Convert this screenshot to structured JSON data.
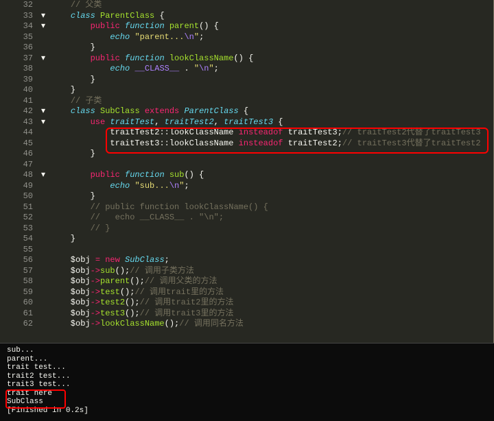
{
  "lines": [
    {
      "num": 32,
      "fold": "",
      "tokens": [
        [
          "    ",
          "pln"
        ],
        [
          "// 父类",
          "c-comment"
        ]
      ]
    },
    {
      "num": 33,
      "fold": "▾",
      "tokens": [
        [
          "    ",
          "pln"
        ],
        [
          "class",
          "c-keyword"
        ],
        [
          " ",
          "pln"
        ],
        [
          "ParentClass",
          "c-class"
        ],
        [
          " {",
          "pln"
        ]
      ]
    },
    {
      "num": 34,
      "fold": "▾",
      "tokens": [
        [
          "        ",
          "pln"
        ],
        [
          "public",
          "c-kw3"
        ],
        [
          " ",
          "pln"
        ],
        [
          "function",
          "c-keyword"
        ],
        [
          " ",
          "pln"
        ],
        [
          "parent",
          "c-func"
        ],
        [
          "() {",
          "pln"
        ]
      ]
    },
    {
      "num": 35,
      "fold": "",
      "tokens": [
        [
          "            ",
          "pln"
        ],
        [
          "echo",
          "c-keyword"
        ],
        [
          " ",
          "pln"
        ],
        [
          "\"parent...",
          "c-string"
        ],
        [
          "\\n",
          "c-escape"
        ],
        [
          "\"",
          "c-string"
        ],
        [
          ";",
          "pln"
        ]
      ]
    },
    {
      "num": 36,
      "fold": "",
      "tokens": [
        [
          "        }",
          "pln"
        ]
      ]
    },
    {
      "num": 37,
      "fold": "▾",
      "tokens": [
        [
          "        ",
          "pln"
        ],
        [
          "public",
          "c-kw3"
        ],
        [
          " ",
          "pln"
        ],
        [
          "function",
          "c-keyword"
        ],
        [
          " ",
          "pln"
        ],
        [
          "lookClassName",
          "c-func"
        ],
        [
          "() {",
          "pln"
        ]
      ]
    },
    {
      "num": 38,
      "fold": "",
      "tokens": [
        [
          "            ",
          "pln"
        ],
        [
          "echo",
          "c-keyword"
        ],
        [
          " ",
          "pln"
        ],
        [
          "__CLASS__",
          "c-const"
        ],
        [
          " . ",
          "pln"
        ],
        [
          "\"",
          "c-string"
        ],
        [
          "\\n",
          "c-escape"
        ],
        [
          "\"",
          "c-string"
        ],
        [
          ";",
          "pln"
        ]
      ]
    },
    {
      "num": 39,
      "fold": "",
      "tokens": [
        [
          "        }",
          "pln"
        ]
      ]
    },
    {
      "num": 40,
      "fold": "",
      "tokens": [
        [
          "    }",
          "pln"
        ]
      ]
    },
    {
      "num": 41,
      "fold": "",
      "tokens": [
        [
          "    ",
          "pln"
        ],
        [
          "// 子类",
          "c-comment"
        ]
      ]
    },
    {
      "num": 42,
      "fold": "▾",
      "tokens": [
        [
          "    ",
          "pln"
        ],
        [
          "class",
          "c-keyword"
        ],
        [
          " ",
          "pln"
        ],
        [
          "SubClass",
          "c-class"
        ],
        [
          " ",
          "pln"
        ],
        [
          "extends",
          "c-kw3"
        ],
        [
          " ",
          "pln"
        ],
        [
          "ParentClass",
          "c-type"
        ],
        [
          " {",
          "pln"
        ]
      ]
    },
    {
      "num": 43,
      "fold": "▾",
      "tokens": [
        [
          "        ",
          "pln"
        ],
        [
          "use",
          "c-kw3"
        ],
        [
          " ",
          "pln"
        ],
        [
          "traitTest",
          "c-type"
        ],
        [
          ", ",
          "pln"
        ],
        [
          "traitTest2",
          "c-type"
        ],
        [
          ", ",
          "pln"
        ],
        [
          "traitTest3",
          "c-type"
        ],
        [
          " {",
          "pln"
        ]
      ]
    },
    {
      "num": 44,
      "fold": "",
      "tokens": [
        [
          "            ",
          "pln"
        ],
        [
          "traitTest2",
          "pln"
        ],
        [
          "::",
          "pln"
        ],
        [
          "lookClassName",
          "pln"
        ],
        [
          " ",
          "pln"
        ],
        [
          "insteadof",
          "c-kw3"
        ],
        [
          " ",
          "pln"
        ],
        [
          "traitTest3",
          "pln"
        ],
        [
          ";",
          "pln"
        ],
        [
          "// traitTest2代替了traitTest3",
          "c-comment"
        ]
      ]
    },
    {
      "num": 45,
      "fold": "",
      "tokens": [
        [
          "            ",
          "pln"
        ],
        [
          "traitTest3",
          "pln"
        ],
        [
          "::",
          "pln"
        ],
        [
          "lookClassName",
          "pln"
        ],
        [
          " ",
          "pln"
        ],
        [
          "insteadof",
          "c-kw3"
        ],
        [
          " ",
          "pln"
        ],
        [
          "traitTest2",
          "pln"
        ],
        [
          ";",
          "pln"
        ],
        [
          "// traitTest3代替了traitTest2",
          "c-comment"
        ]
      ]
    },
    {
      "num": 46,
      "fold": "",
      "tokens": [
        [
          "        }",
          "pln"
        ]
      ]
    },
    {
      "num": 47,
      "fold": "",
      "tokens": [
        [
          "",
          "pln"
        ]
      ]
    },
    {
      "num": 48,
      "fold": "▾",
      "tokens": [
        [
          "        ",
          "pln"
        ],
        [
          "public",
          "c-kw3"
        ],
        [
          " ",
          "pln"
        ],
        [
          "function",
          "c-keyword"
        ],
        [
          " ",
          "pln"
        ],
        [
          "sub",
          "c-func"
        ],
        [
          "() {",
          "pln"
        ]
      ]
    },
    {
      "num": 49,
      "fold": "",
      "tokens": [
        [
          "            ",
          "pln"
        ],
        [
          "echo",
          "c-keyword"
        ],
        [
          " ",
          "pln"
        ],
        [
          "\"sub...",
          "c-string"
        ],
        [
          "\\n",
          "c-escape"
        ],
        [
          "\"",
          "c-string"
        ],
        [
          ";",
          "pln"
        ]
      ]
    },
    {
      "num": 50,
      "fold": "",
      "tokens": [
        [
          "        }",
          "pln"
        ]
      ]
    },
    {
      "num": 51,
      "fold": "",
      "tokens": [
        [
          "        ",
          "pln"
        ],
        [
          "// public function lookClassName() {",
          "c-comment"
        ]
      ]
    },
    {
      "num": 52,
      "fold": "",
      "tokens": [
        [
          "        ",
          "pln"
        ],
        [
          "//   echo __CLASS__ . \"\\n\";",
          "c-comment"
        ]
      ]
    },
    {
      "num": 53,
      "fold": "",
      "tokens": [
        [
          "        ",
          "pln"
        ],
        [
          "// }",
          "c-comment"
        ]
      ]
    },
    {
      "num": 54,
      "fold": "",
      "tokens": [
        [
          "    }",
          "pln"
        ]
      ]
    },
    {
      "num": 55,
      "fold": "",
      "tokens": [
        [
          "",
          "pln"
        ]
      ]
    },
    {
      "num": 56,
      "fold": "",
      "tokens": [
        [
          "    $obj ",
          "pln"
        ],
        [
          "=",
          "c-op"
        ],
        [
          " ",
          "pln"
        ],
        [
          "new",
          "c-kw3"
        ],
        [
          " ",
          "pln"
        ],
        [
          "SubClass",
          "c-type"
        ],
        [
          ";",
          "pln"
        ]
      ]
    },
    {
      "num": 57,
      "fold": "",
      "tokens": [
        [
          "    $obj",
          "pln"
        ],
        [
          "->",
          "c-op"
        ],
        [
          "sub",
          "c-func"
        ],
        [
          "();",
          "pln"
        ],
        [
          "// 调用子类方法",
          "c-comment"
        ]
      ]
    },
    {
      "num": 58,
      "fold": "",
      "tokens": [
        [
          "    $obj",
          "pln"
        ],
        [
          "->",
          "c-op"
        ],
        [
          "parent",
          "c-func"
        ],
        [
          "();",
          "pln"
        ],
        [
          "// 调用父类的方法",
          "c-comment"
        ]
      ]
    },
    {
      "num": 59,
      "fold": "",
      "tokens": [
        [
          "    $obj",
          "pln"
        ],
        [
          "->",
          "c-op"
        ],
        [
          "test",
          "c-func"
        ],
        [
          "();",
          "pln"
        ],
        [
          "// 调用trait里的方法",
          "c-comment"
        ]
      ]
    },
    {
      "num": 60,
      "fold": "",
      "tokens": [
        [
          "    $obj",
          "pln"
        ],
        [
          "->",
          "c-op"
        ],
        [
          "test2",
          "c-func"
        ],
        [
          "();",
          "pln"
        ],
        [
          "// 调用trait2里的方法",
          "c-comment"
        ]
      ]
    },
    {
      "num": 61,
      "fold": "",
      "tokens": [
        [
          "    $obj",
          "pln"
        ],
        [
          "->",
          "c-op"
        ],
        [
          "test3",
          "c-func"
        ],
        [
          "();",
          "pln"
        ],
        [
          "// 调用trait3里的方法",
          "c-comment"
        ]
      ]
    },
    {
      "num": 62,
      "fold": "",
      "tokens": [
        [
          "    $obj",
          "pln"
        ],
        [
          "->",
          "c-op"
        ],
        [
          "lookClassName",
          "c-func"
        ],
        [
          "();",
          "pln"
        ],
        [
          "// 调用同名方法",
          "c-comment"
        ]
      ]
    }
  ],
  "output": [
    "sub...",
    "parent...",
    "trait test...",
    "trait2 test...",
    "trait3 test...",
    "trait here",
    "SubClass",
    "[Finished in 0.2s]"
  ]
}
